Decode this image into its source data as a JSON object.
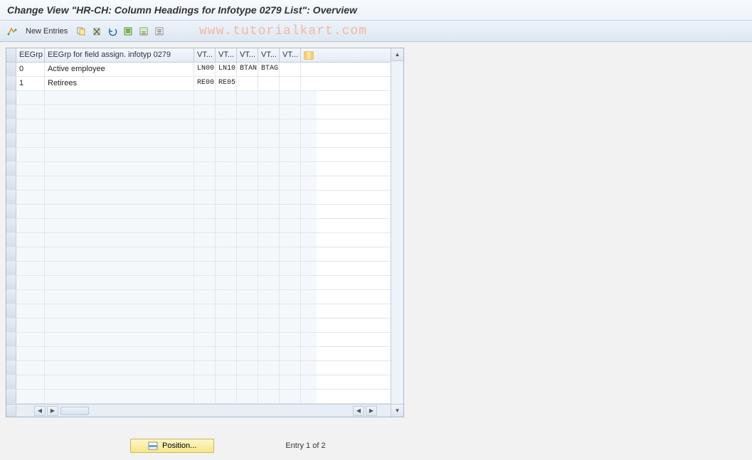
{
  "title": "Change View \"HR-CH: Column Headings for Infotype 0279 List\": Overview",
  "toolbar": {
    "new_entries_label": "New Entries"
  },
  "watermark": "www.tutorialkart.com",
  "grid": {
    "columns": {
      "eegrp": "EEGrp",
      "desc": "EEGrp for field assign. infotyp 0279",
      "vt1": "VT...",
      "vt2": "VT...",
      "vt3": "VT...",
      "vt4": "VT...",
      "vt5": "VT..."
    },
    "rows": [
      {
        "eegrp": "0",
        "desc": "Active employee",
        "vt1": "LN00",
        "vt2": "LN10",
        "vt3": "BTAN",
        "vt4": "BTAG",
        "vt5": ""
      },
      {
        "eegrp": "1",
        "desc": "Retirees",
        "vt1": "RE00",
        "vt2": "RE05",
        "vt3": "",
        "vt4": "",
        "vt5": ""
      }
    ],
    "empty_row_count": 22
  },
  "footer": {
    "position_label": "Position...",
    "entry_text": "Entry 1 of 2"
  }
}
